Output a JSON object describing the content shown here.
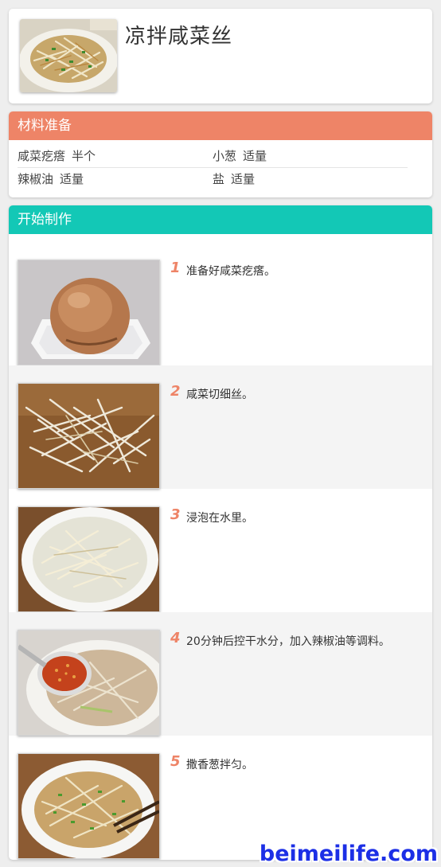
{
  "recipe": {
    "title": "凉拌咸菜丝",
    "hero_image": "shredded-pickle-dish-photo"
  },
  "ingredients": {
    "heading": "材料准备",
    "rows": [
      [
        {
          "name": "咸菜疙瘩",
          "qty": "半个"
        },
        {
          "name": "小葱",
          "qty": "适量"
        }
      ],
      [
        {
          "name": "辣椒油",
          "qty": "适量"
        },
        {
          "name": "盐",
          "qty": "适量"
        }
      ]
    ]
  },
  "steps": {
    "heading": "开始制作",
    "items": [
      {
        "num": "1",
        "text": "准备好咸菜疙瘩。",
        "image": "whole-pickle-on-plate-photo"
      },
      {
        "num": "2",
        "text": "咸菜切细丝。",
        "image": "shredded-pickle-on-board-photo"
      },
      {
        "num": "3",
        "text": "浸泡在水里。",
        "image": "pickle-soaking-in-bowl-photo"
      },
      {
        "num": "4",
        "text": "20分钟后控干水分，加入辣椒油等调料。",
        "image": "pickle-with-chili-oil-photo"
      },
      {
        "num": "5",
        "text": "撒香葱拌匀。",
        "image": "pickle-with-scallion-photo"
      }
    ]
  },
  "watermark": "beimeilife.com",
  "colors": {
    "ingredients_header": "#ee8467",
    "steps_header": "#13c8b6",
    "step_number": "#ee8467",
    "watermark": "#1c2fe6"
  }
}
